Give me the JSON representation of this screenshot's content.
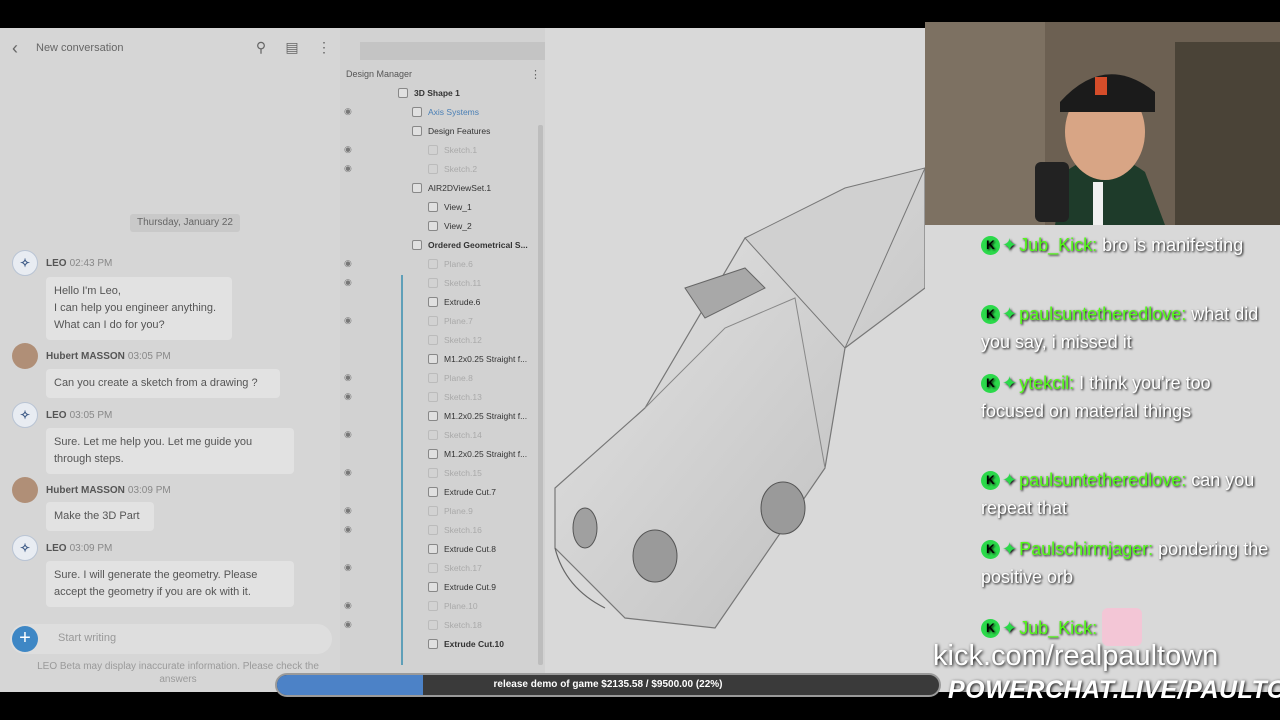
{
  "colors": {
    "accent": "#3e87c5",
    "kick_green": "#53fc18",
    "progress_fill": "#4c82c7"
  },
  "chat": {
    "header_title": "New conversation",
    "date": "Thursday, January 22",
    "messages": [
      {
        "sender": "LEO",
        "time": "02:43 PM",
        "text": "Hello I'm Leo,\nI can help you engineer anything.\nWhat can I do for you?"
      },
      {
        "sender": "Hubert MASSON",
        "time": "03:05 PM",
        "text": "Can you create a sketch from a drawing ?"
      },
      {
        "sender": "LEO",
        "time": "03:05 PM",
        "text": "Sure. Let me help you. Let me guide you\nthrough steps."
      },
      {
        "sender": "Hubert MASSON",
        "time": "03:09 PM",
        "text": "Make the 3D Part"
      },
      {
        "sender": "LEO",
        "time": "03:09 PM",
        "text": "Sure. I will generate the geometry. Please\naccept the geometry if you are ok with it."
      }
    ],
    "composer_placeholder": "Start writing",
    "disclaimer": "LEO Beta may display inaccurate information. Please check the answers"
  },
  "design_manager": {
    "title": "Design Manager",
    "tree": [
      {
        "label": "3D Shape 1",
        "style": "bold"
      },
      {
        "label": "Axis Systems",
        "style": "link"
      },
      {
        "label": "Design Features",
        "style": "normal"
      },
      {
        "label": "Sketch.1",
        "style": "faded"
      },
      {
        "label": "Sketch.2",
        "style": "faded"
      },
      {
        "label": "AIR2DViewSet.1",
        "style": "normal"
      },
      {
        "label": "View_1",
        "style": "normal"
      },
      {
        "label": "View_2",
        "style": "normal"
      },
      {
        "label": "Ordered Geometrical S...",
        "style": "bold"
      },
      {
        "label": "Plane.6",
        "style": "faded"
      },
      {
        "label": "Sketch.11",
        "style": "faded"
      },
      {
        "label": "Extrude.6",
        "style": "normal"
      },
      {
        "label": "Plane.7",
        "style": "faded"
      },
      {
        "label": "Sketch.12",
        "style": "faded"
      },
      {
        "label": "M1.2x0.25 Straight f...",
        "style": "normal"
      },
      {
        "label": "Plane.8",
        "style": "faded"
      },
      {
        "label": "Sketch.13",
        "style": "faded"
      },
      {
        "label": "M1.2x0.25 Straight f...",
        "style": "normal"
      },
      {
        "label": "Sketch.14",
        "style": "faded"
      },
      {
        "label": "M1.2x0.25 Straight f...",
        "style": "normal"
      },
      {
        "label": "Sketch.15",
        "style": "faded"
      },
      {
        "label": "Extrude Cut.7",
        "style": "normal"
      },
      {
        "label": "Plane.9",
        "style": "faded"
      },
      {
        "label": "Sketch.16",
        "style": "faded"
      },
      {
        "label": "Extrude Cut.8",
        "style": "normal"
      },
      {
        "label": "Sketch.17",
        "style": "faded"
      },
      {
        "label": "Extrude Cut.9",
        "style": "normal"
      },
      {
        "label": "Plane.10",
        "style": "faded"
      },
      {
        "label": "Sketch.18",
        "style": "faded"
      },
      {
        "label": "Extrude Cut.10",
        "style": "bold"
      }
    ]
  },
  "stream_chat": [
    {
      "user": "Jub_Kick:",
      "text": " bro is manifesting"
    },
    {
      "user": "paulsuntetheredlove:",
      "text": " what did you say, i missed it"
    },
    {
      "user": "ytekcil:",
      "text": " I think you're too focused on material things"
    },
    {
      "user": "paulsuntetheredlove:",
      "text": " can you repeat that"
    },
    {
      "user": "Paulschirmjager:",
      "text": " pondering the positive orb"
    },
    {
      "user": "Jub_Kick:",
      "text": ""
    }
  ],
  "overlay": {
    "kick_url": "kick.com/realpaultown",
    "powerchat": "POWERCHAT.LIVE/PAULTOWN",
    "progress_text": "release demo of game $2135.58 / $9500.00 (22%)",
    "progress_value": 0.22
  }
}
